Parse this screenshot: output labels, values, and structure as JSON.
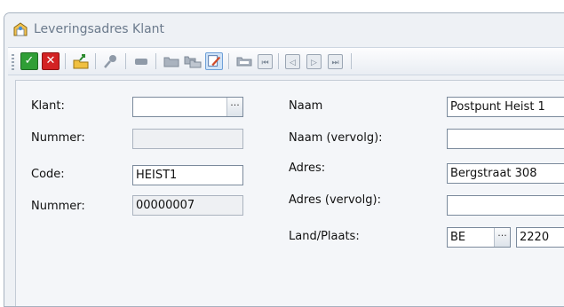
{
  "window": {
    "title": "Leveringsadres Klant"
  },
  "colors": {
    "window_bg": "#eef1f5",
    "accent": "#3b7fd0",
    "confirm": "#2f9e36",
    "cancel": "#d32323"
  },
  "toolbar": {
    "buttons": [
      {
        "icon": "confirm-check-icon",
        "glyph": "✓"
      },
      {
        "icon": "cancel-x-icon",
        "glyph": "✕"
      },
      {
        "icon": "export-folder-arrow-icon"
      },
      {
        "icon": "search-pin-icon"
      },
      {
        "icon": "stop-bar-icon"
      },
      {
        "icon": "folder-icon"
      },
      {
        "icon": "folders-copy-icon"
      },
      {
        "icon": "edit-document-icon"
      },
      {
        "icon": "folder-open-icon"
      },
      {
        "icon": "first-record-icon",
        "glyph": "⏮"
      },
      {
        "icon": "previous-record-icon",
        "glyph": "◁"
      },
      {
        "icon": "next-record-icon",
        "glyph": "▷"
      },
      {
        "icon": "last-record-icon",
        "glyph": "⏭"
      }
    ]
  },
  "form": {
    "left": {
      "klant_label": "Klant:",
      "klant_value": "",
      "klant_button": "···",
      "nummer_label": "Nummer:",
      "nummer_value": "",
      "code_label": "Code:",
      "code_value": "HEIST1",
      "nummer2_label": "Nummer:",
      "nummer2_value": "00000007"
    },
    "right": {
      "naam_label": "Naam",
      "naam_value": "Postpunt Heist 1",
      "naam_vervolg_label": "Naam (vervolg):",
      "naam_vervolg_value": "",
      "adres_label": "Adres:",
      "adres_value": "Bergstraat 308",
      "adres_vervolg_label": "Adres (vervolg):",
      "adres_vervolg_value": "",
      "land_plaats_label": "Land/Plaats:",
      "land_value": "BE",
      "land_button": "···",
      "postcode_value": "2220"
    }
  }
}
